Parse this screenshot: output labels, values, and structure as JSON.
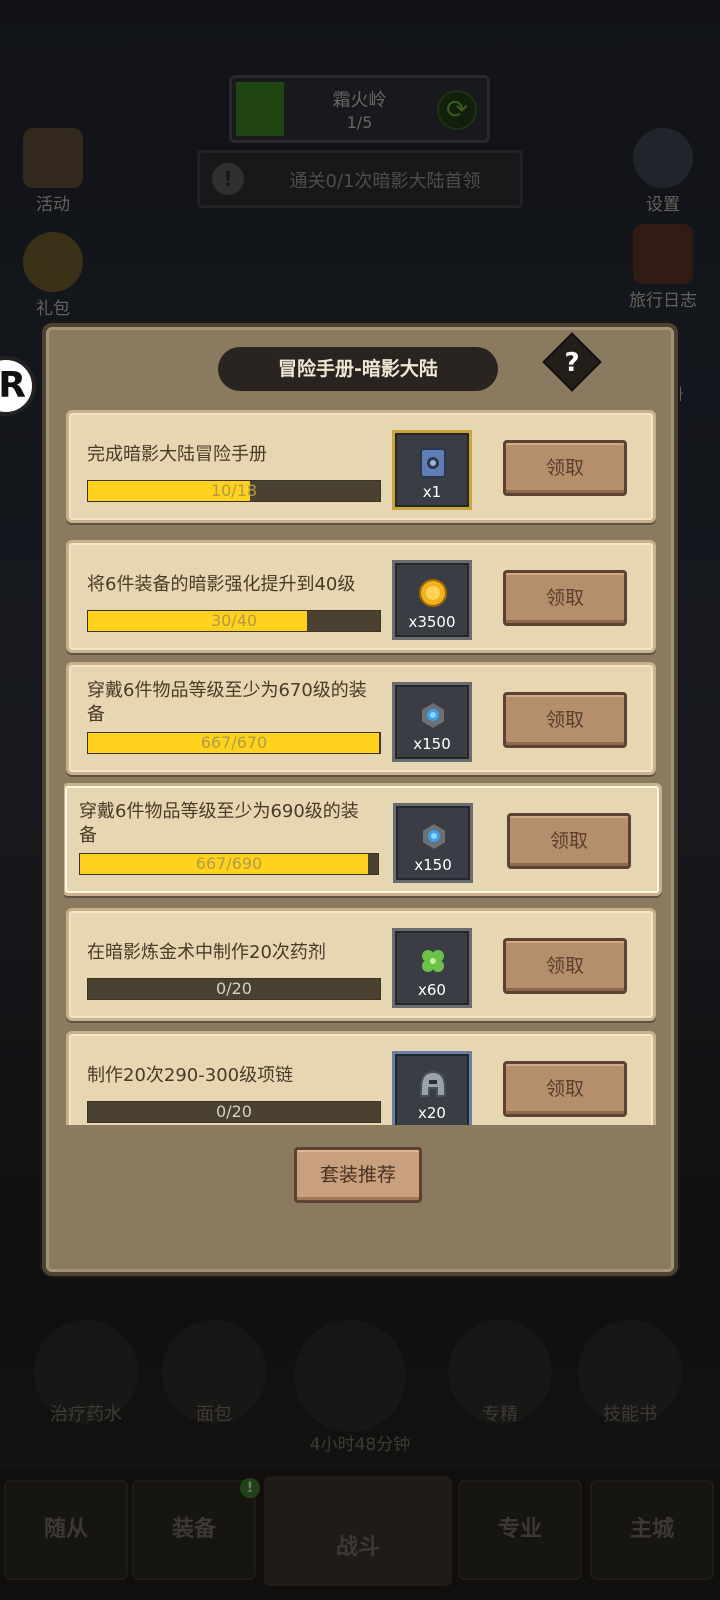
{
  "background": {
    "stage": {
      "name": "霜火岭",
      "progress": "1/5"
    },
    "boss_task": "通关0/1次暗影大陆首领",
    "side_buttons": {
      "activity": "活动",
      "gift": "礼包",
      "settings": "设置",
      "travel_log": "旅行日志",
      "partial_right": "册"
    },
    "hero_badge": "R",
    "consumables": [
      "治疗药水",
      "面包",
      "专精",
      "技能书"
    ],
    "chest_timer": "4小时48分钟",
    "tabs": {
      "followers": "随从",
      "equipment": "装备",
      "battle": "战斗",
      "profession": "专业",
      "main_city": "主城",
      "equipment_badge": "!"
    }
  },
  "dialog": {
    "title": "冒险手册-暗影大陆",
    "help_label": "?",
    "claim_label": "领取",
    "suit_button": "套装推荐",
    "tasks": [
      {
        "desc": "完成暗影大陆冒险手册",
        "progress_text": "10/18",
        "progress": 0.556,
        "reward_icon": "book-icon",
        "reward_qty": "x1"
      },
      {
        "desc": "将6件装备的暗影强化提升到40级",
        "progress_text": "30/40",
        "progress": 0.75,
        "reward_icon": "gold-coin-icon",
        "reward_qty": "x3500"
      },
      {
        "desc": "穿戴6件物品等级至少为670级的装备",
        "progress_text": "667/670",
        "progress": 0.995,
        "reward_icon": "gem-stone-icon",
        "reward_qty": "x150"
      },
      {
        "desc": "穿戴6件物品等级至少为690级的装备",
        "progress_text": "667/690",
        "progress": 0.967,
        "reward_icon": "gem-stone-icon",
        "reward_qty": "x150"
      },
      {
        "desc": "在暗影炼金术中制作20次药剂",
        "progress_text": "0/20",
        "progress": 0,
        "reward_icon": "clover-icon",
        "reward_qty": "x60"
      },
      {
        "desc": "制作20次290-300级项链",
        "progress_text": "0/20",
        "progress": 0,
        "reward_icon": "helmet-icon",
        "reward_qty": "x20"
      }
    ]
  }
}
